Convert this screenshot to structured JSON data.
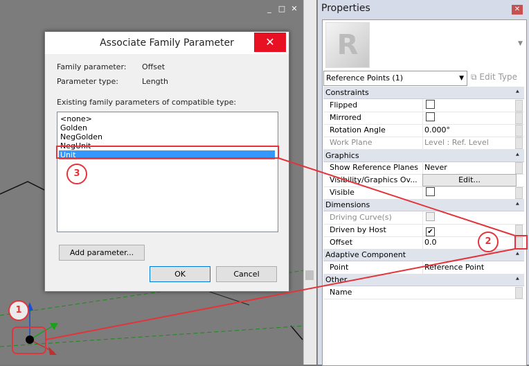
{
  "viewport": {
    "controls": [
      "_",
      "□",
      "✕"
    ]
  },
  "dialog": {
    "title": "Associate Family Parameter",
    "close_icon": "✕",
    "family_param_label": "Family parameter:",
    "family_param_value": "Offset",
    "param_type_label": "Parameter type:",
    "param_type_value": "Length",
    "existing_label": "Existing family parameters of compatible type:",
    "list_items": [
      "<none>",
      "Golden",
      "NegGolden",
      "NegUnit",
      "Unit"
    ],
    "selected_item": "Unit",
    "add_param_label": "Add parameter...",
    "ok_label": "OK",
    "cancel_label": "Cancel"
  },
  "properties": {
    "title": "Properties",
    "close_icon": "✕",
    "type_icon": "R",
    "instance_select": "Reference Points (1)",
    "edit_type_label": "Edit Type",
    "groups": {
      "constraints": "Constraints",
      "graphics": "Graphics",
      "dimensions": "Dimensions",
      "adaptive": "Adaptive Component",
      "other": "Other"
    },
    "rows": {
      "flipped": {
        "label": "Flipped",
        "checked": false
      },
      "mirrored": {
        "label": "Mirrored",
        "checked": false
      },
      "rotation": {
        "label": "Rotation Angle",
        "value": "0.000°"
      },
      "work_plane": {
        "label": "Work Plane",
        "value": "Level : Ref. Level"
      },
      "show_ref_planes": {
        "label": "Show Reference Planes",
        "value": "Never"
      },
      "vis_graphics": {
        "label": "Visibility/Graphics Ov...",
        "button": "Edit..."
      },
      "visible": {
        "label": "Visible",
        "checked": false
      },
      "driving_curve": {
        "label": "Driving Curve(s)",
        "checked": false
      },
      "driven_by_host": {
        "label": "Driven by Host",
        "checked": true
      },
      "offset": {
        "label": "Offset",
        "value": "0.0"
      },
      "point": {
        "label": "Point",
        "value": "Reference Point"
      },
      "name": {
        "label": "Name",
        "value": ""
      }
    }
  },
  "annotations": {
    "badge1": "1",
    "badge2": "2",
    "badge3": "3",
    "color": "#e2343a"
  }
}
